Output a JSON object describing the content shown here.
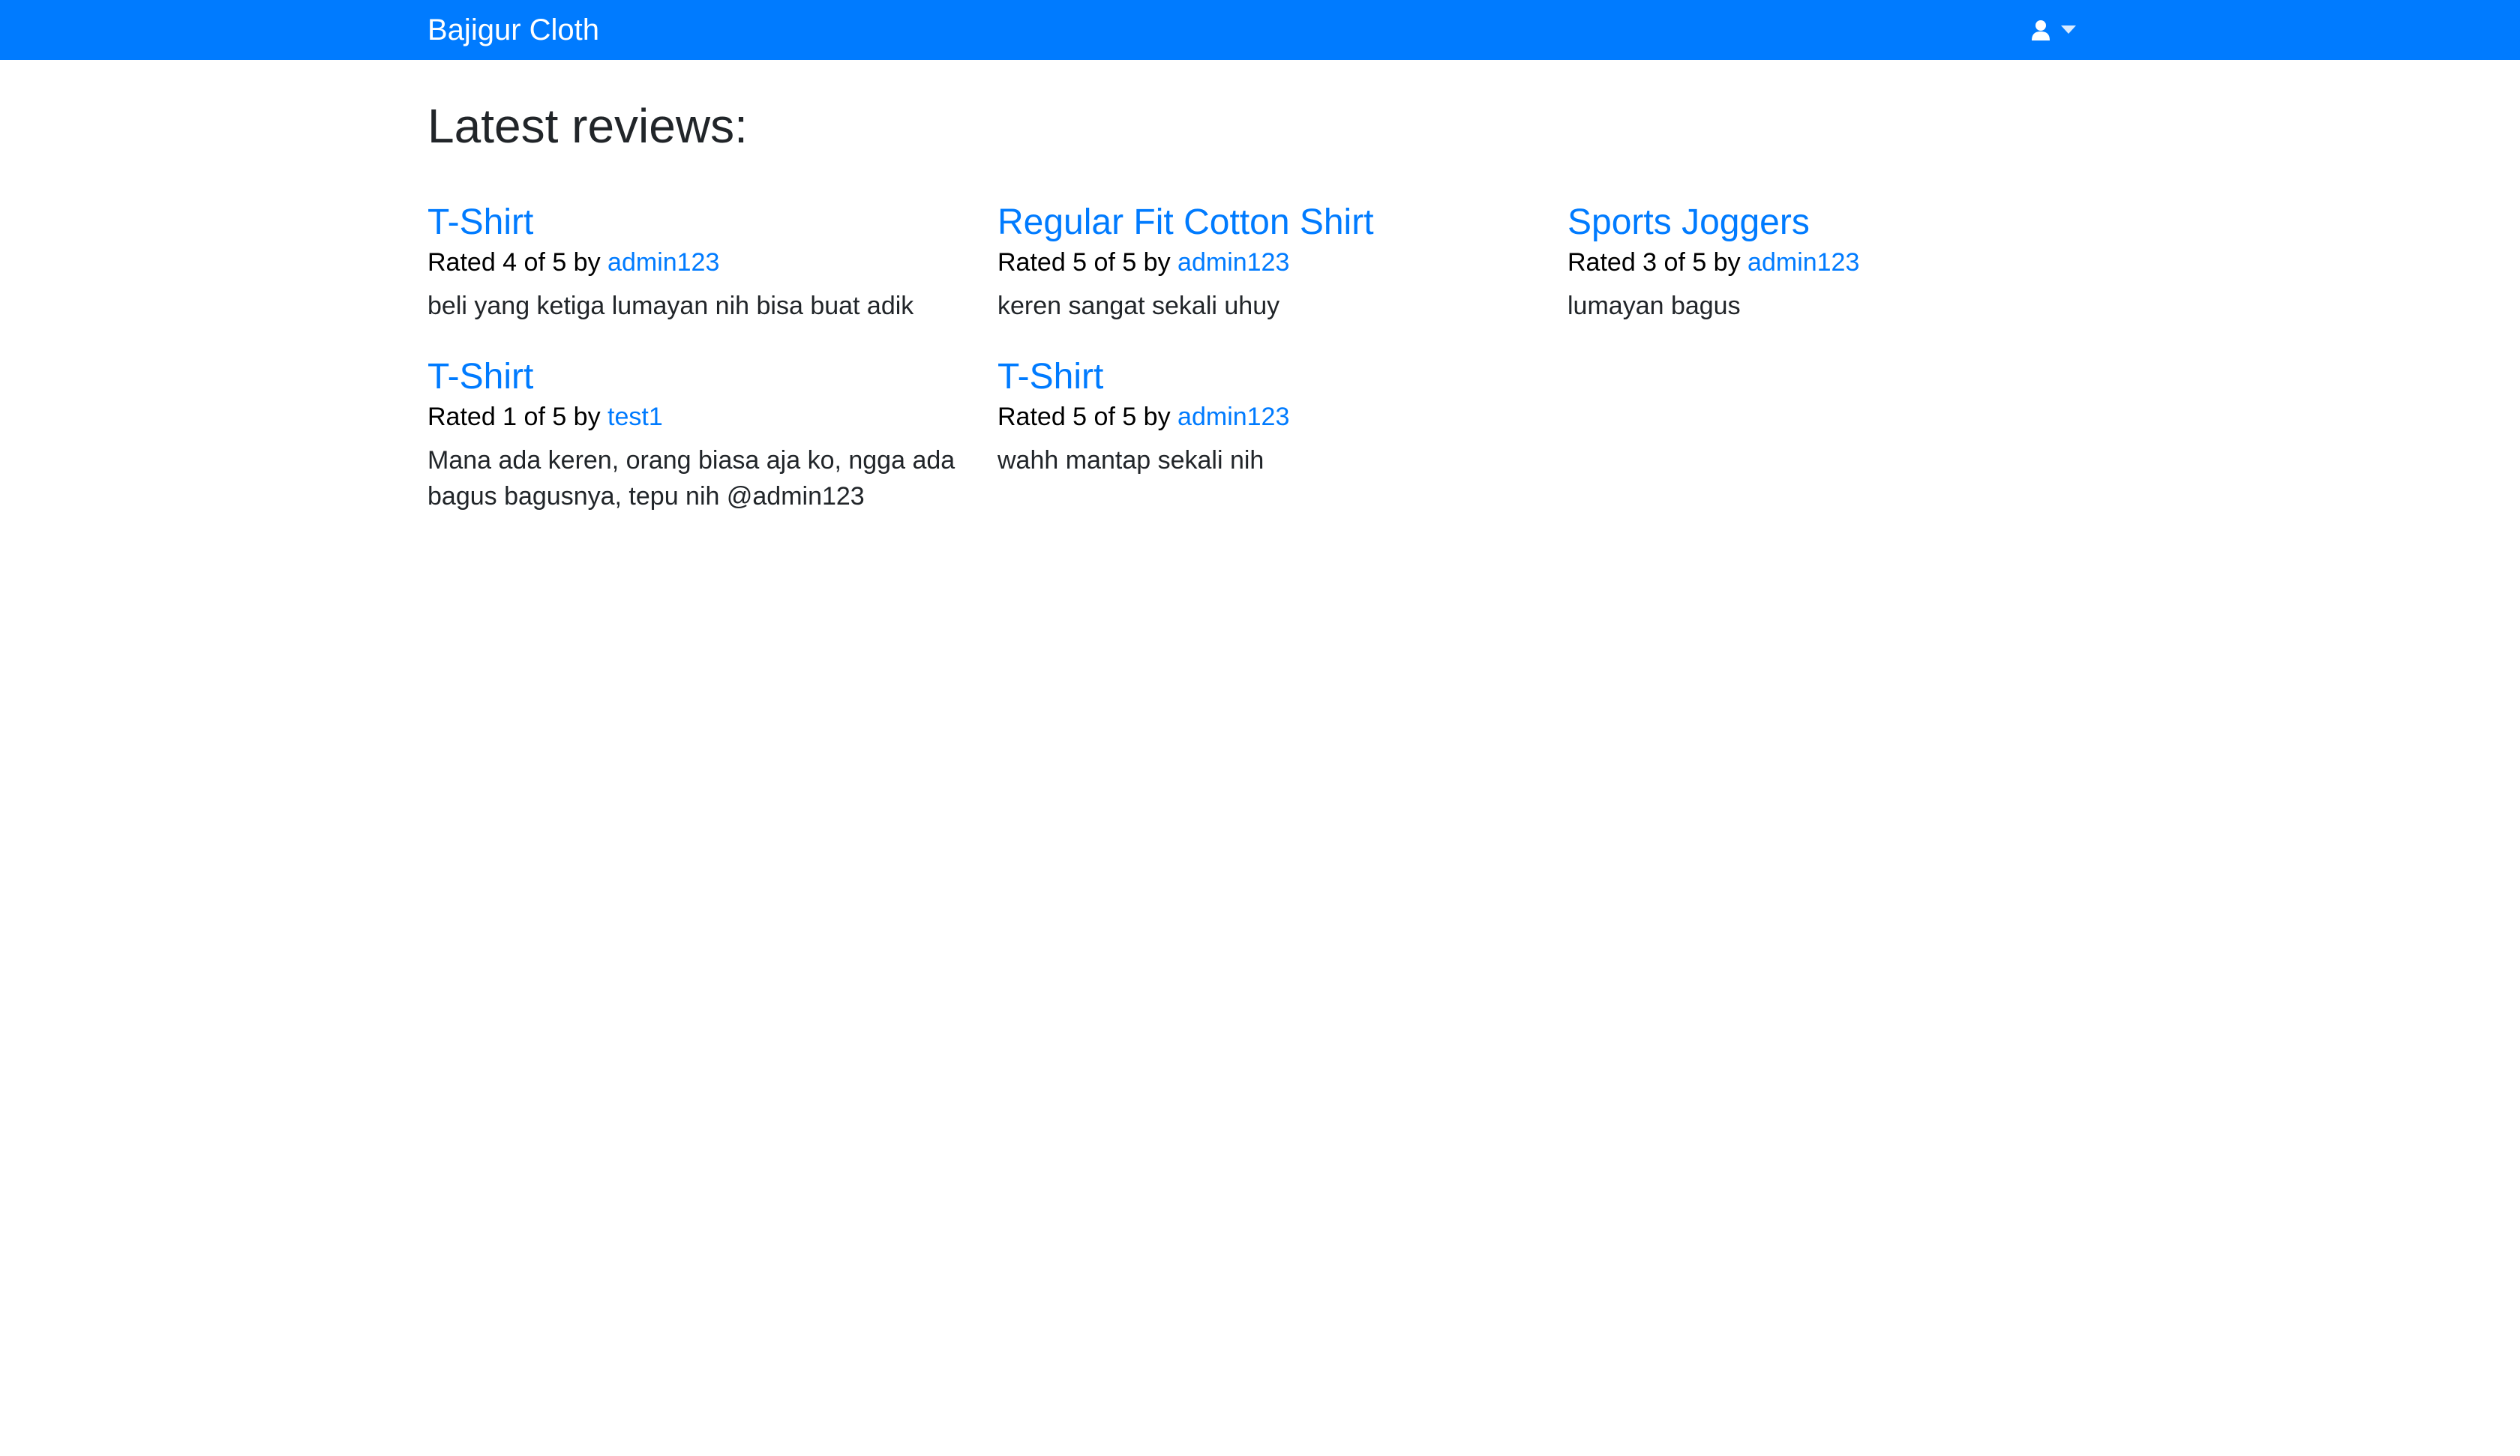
{
  "navbar": {
    "brand": "Bajigur Cloth",
    "user_icon": "user-icon",
    "caret_icon": "caret-down-icon",
    "background": "#007bff"
  },
  "main": {
    "title": "Latest reviews:",
    "reviews": [
      {
        "product": "T-Shirt",
        "rating_text": "Rated 4 of 5 by ",
        "author": "admin123",
        "text": "beli yang ketiga lumayan nih bisa buat adik"
      },
      {
        "product": "Regular Fit Cotton Shirt",
        "rating_text": "Rated 5 of 5 by ",
        "author": "admin123",
        "text": "keren sangat sekali uhuy"
      },
      {
        "product": "Sports Joggers",
        "rating_text": "Rated 3 of 5 by ",
        "author": "admin123",
        "text": "lumayan bagus"
      },
      {
        "product": "T-Shirt",
        "rating_text": "Rated 1 of 5 by ",
        "author": "test1",
        "text": "Mana ada keren, orang biasa aja ko, ngga ada bagus bagusnya, tepu nih @admin123"
      },
      {
        "product": "T-Shirt",
        "rating_text": "Rated 5 of 5 by ",
        "author": "admin123",
        "text": "wahh mantap sekali nih"
      }
    ]
  },
  "colors": {
    "accent": "#007bff",
    "text": "#212529"
  }
}
